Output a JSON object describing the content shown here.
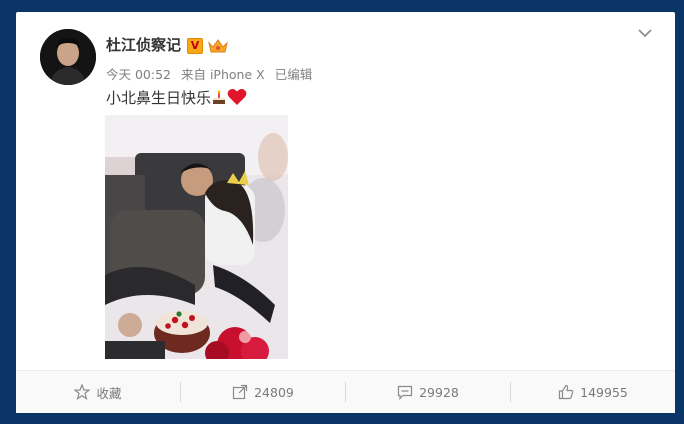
{
  "post": {
    "author": "杜江侦察记",
    "timestamp": "今天 00:52",
    "source": "来自 iPhone X",
    "edited": "已编辑",
    "text": "小北鼻生日快乐"
  },
  "verification_badge": "V",
  "icons": [
    "crown-icon",
    "chevron-down-icon",
    "cake-icon",
    "heart-icon",
    "star-icon",
    "share-icon",
    "comment-icon",
    "like-icon"
  ],
  "actions": {
    "favorite": "收藏",
    "repost": "24809",
    "comment": "29928",
    "like": "149955"
  },
  "colors": {
    "background": "#0b3566",
    "card": "#ffffff",
    "heart": "#e0162b",
    "badge": "#f9a81a"
  }
}
